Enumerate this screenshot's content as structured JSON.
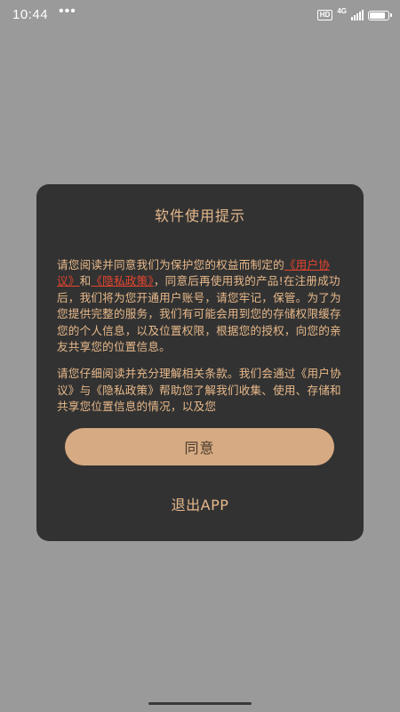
{
  "status_bar": {
    "time": "10:44",
    "dots": "•••",
    "hd_label": "HD",
    "network_label": "4G",
    "battery_level": 0.85
  },
  "dialog": {
    "title": "软件使用提示",
    "paragraph1": {
      "prefix": "请您阅读并同意我们为保护您的权益而制定的",
      "link_user_agreement": "《用户协议》",
      "conjunction": "和",
      "link_privacy_policy": "《隐私政策》",
      "suffix": "，同意后再使用我的产品!在注册成功后，我们将为您开通用户账号，请您牢记，保管。为了为您提供完整的服务，我们有可能会用到您的存储权限缓存您的个人信息，以及位置权限，根据您的授权，向您的亲友共享您的位置信息。"
    },
    "paragraph2": "请您仔细阅读并充分理解相关条款。我们会通过《用户协议》与《隐私政策》帮助您了解我们收集、使用、存储和共享您位置信息的情况，以及您",
    "agree_label": "同意",
    "exit_label": "退出APP"
  },
  "colors": {
    "backdrop": "#9a9a9a",
    "dialog_bg": "#323232",
    "accent_text": "#e8b98a",
    "link": "#e5452f",
    "button_bg": "#d6aa82"
  }
}
